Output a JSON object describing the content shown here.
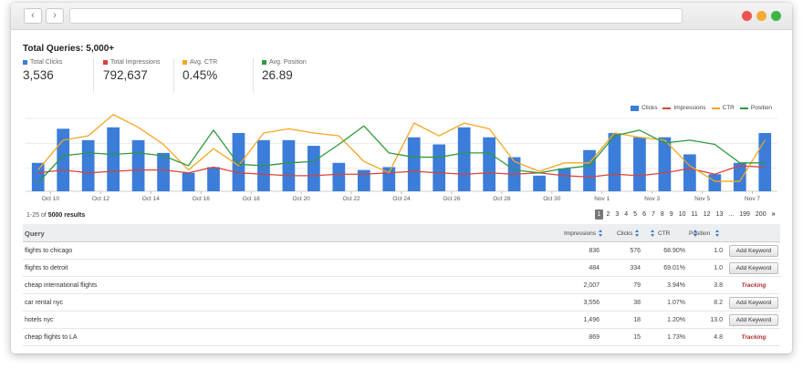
{
  "browser": {
    "back_glyph": "‹",
    "forward_glyph": "›",
    "url": ""
  },
  "summary": {
    "title": "Total Queries: 5,000+",
    "stats": [
      {
        "label": "Total Clicks",
        "value": "3,536",
        "color": "#3b7dd8"
      },
      {
        "label": "Total Impressions",
        "value": "792,637",
        "color": "#d9433a"
      },
      {
        "label": "Avg. CTR",
        "value": "0.45%",
        "color": "#f5a623"
      },
      {
        "label": "Avg. Position",
        "value": "26.89",
        "color": "#2e9a3e"
      }
    ]
  },
  "legend": {
    "clicks": "Clicks",
    "impressions": "Impressions",
    "ctr": "CTR",
    "position": "Position"
  },
  "chart_data": {
    "type": "bar",
    "ylim": [
      0,
      100
    ],
    "grid": true,
    "legend_position": "top-right",
    "x_tick_labels": [
      "Oct 10",
      "Oct 12",
      "Oct 14",
      "Oct 16",
      "Oct 18",
      "Oct 20",
      "Oct 22",
      "Oct 24",
      "Oct 26",
      "Oct 28",
      "Oct 30",
      "Nov 1",
      "Nov 3",
      "Nov 5",
      "Nov 7"
    ],
    "x_tick_index": [
      1,
      3,
      5,
      7,
      9,
      11,
      13,
      15,
      17,
      19,
      21,
      23,
      25,
      27,
      29
    ],
    "n_points": 30,
    "series": [
      {
        "name": "Clicks",
        "kind": "bar",
        "color": "#3b7dd8",
        "values": [
          40,
          88,
          72,
          90,
          72,
          54,
          26,
          34,
          82,
          72,
          72,
          64,
          40,
          30,
          34,
          76,
          66,
          90,
          76,
          48,
          22,
          32,
          58,
          82,
          76,
          76,
          52,
          24,
          40,
          82
        ]
      },
      {
        "name": "Impressions",
        "kind": "line",
        "color": "#d9433a",
        "values": [
          26,
          30,
          26,
          28,
          30,
          30,
          26,
          34,
          26,
          24,
          22,
          22,
          24,
          24,
          26,
          28,
          26,
          24,
          26,
          24,
          26,
          22,
          20,
          24,
          22,
          26,
          32,
          24,
          36,
          34
        ]
      },
      {
        "name": "CTR",
        "kind": "line",
        "color": "#f5a623",
        "values": [
          30,
          72,
          78,
          108,
          90,
          66,
          30,
          60,
          36,
          82,
          88,
          82,
          78,
          42,
          26,
          96,
          78,
          96,
          88,
          42,
          28,
          40,
          40,
          82,
          76,
          72,
          36,
          14,
          14,
          72
        ]
      },
      {
        "name": "Position",
        "kind": "line",
        "color": "#2e9a3e",
        "values": [
          12,
          50,
          54,
          52,
          54,
          50,
          36,
          86,
          38,
          36,
          40,
          42,
          66,
          92,
          54,
          48,
          48,
          54,
          54,
          30,
          26,
          32,
          36,
          78,
          86,
          68,
          72,
          66,
          40,
          40
        ]
      }
    ]
  },
  "table": {
    "results_prefix": "1-25 of ",
    "results_total": "5000 results",
    "pages": [
      "1",
      "2",
      "3",
      "4",
      "5",
      "6",
      "7",
      "8",
      "9",
      "10",
      "11",
      "12",
      "13",
      "...",
      "199",
      "200",
      "»"
    ],
    "headers": {
      "query": "Query",
      "impressions": "Impressions",
      "clicks": "Clicks",
      "ctr": "CTR",
      "position": "Position"
    },
    "add_keyword_label": "Add Keyword",
    "tracking_label": "Tracking",
    "rows": [
      {
        "query": "flights to chicago",
        "impressions": "836",
        "clicks": "576",
        "ctr": "68.90%",
        "position": "1.0",
        "action": "add"
      },
      {
        "query": "flights to detroit",
        "impressions": "484",
        "clicks": "334",
        "ctr": "69.01%",
        "position": "1.0",
        "action": "add"
      },
      {
        "query": "cheap international flights",
        "impressions": "2,007",
        "clicks": "79",
        "ctr": "3.94%",
        "position": "3.8",
        "action": "tracking"
      },
      {
        "query": "car rental nyc",
        "impressions": "3,556",
        "clicks": "38",
        "ctr": "1.07%",
        "position": "8.2",
        "action": "add"
      },
      {
        "query": "hotels nyc",
        "impressions": "1,496",
        "clicks": "18",
        "ctr": "1.20%",
        "position": "13.0",
        "action": "add"
      },
      {
        "query": "cheap flights to LA",
        "impressions": "869",
        "clicks": "15",
        "ctr": "1.73%",
        "position": "4.8",
        "action": "tracking"
      }
    ]
  }
}
